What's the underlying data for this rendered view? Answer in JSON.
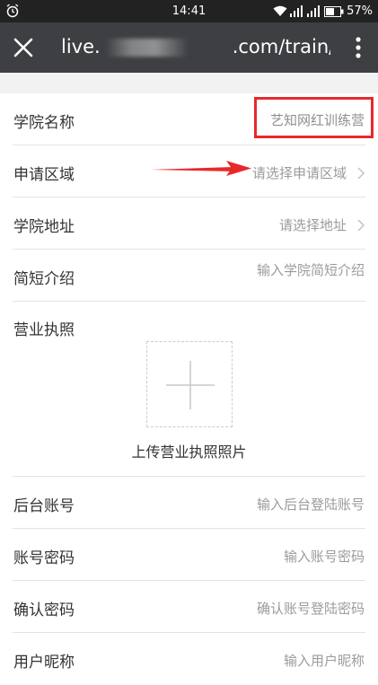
{
  "status_bar": {
    "time": "14:41",
    "battery_percent": "57%",
    "icons": [
      "alarm-icon",
      "wifi-icon",
      "signal-icon",
      "signal-icon",
      "battery-icon"
    ]
  },
  "toolbar": {
    "url": "live.       .com/train/ind...",
    "close_icon": "close-icon",
    "more_icon": "more-vertical-icon"
  },
  "form": {
    "rows": [
      {
        "label": "学院名称",
        "value": "艺知网红训练营",
        "chevron": false
      },
      {
        "label": "申请区域",
        "value": "请选择申请区域",
        "chevron": true
      },
      {
        "label": "学院地址",
        "value": "请选择地址",
        "chevron": true
      },
      {
        "label": "简短介绍",
        "value": "输入学院简短介绍",
        "chevron": false
      }
    ],
    "license": {
      "label": "营业执照",
      "upload_caption": "上传营业执照照片"
    },
    "rows2": [
      {
        "label": "后台账号",
        "value": "输入后台登陆账号"
      },
      {
        "label": "账号密码",
        "value": "输入账号密码"
      },
      {
        "label": "确认密码",
        "value": "确认账号登陆密码"
      },
      {
        "label": "用户昵称",
        "value": "输入用户昵称"
      }
    ]
  },
  "annotations": {
    "highlight_color": "#e8282b"
  }
}
